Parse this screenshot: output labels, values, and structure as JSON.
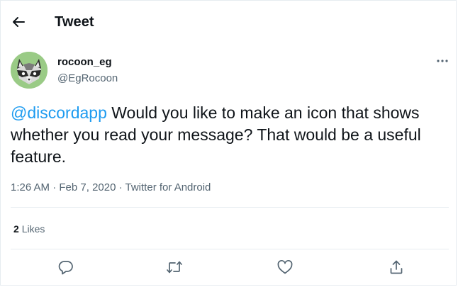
{
  "header": {
    "title": "Tweet",
    "back_icon": "arrow-left-icon"
  },
  "author": {
    "display_name": "rocoon_eg",
    "handle": "@EgRocoon",
    "avatar_icon": "raccoon-avatar",
    "more_icon": "ellipsis-icon"
  },
  "tweet": {
    "mention": "@discordapp",
    "text": " Would you like to make an icon that shows whether you read your message?  That would be a useful feature."
  },
  "meta": {
    "time": "1:26 AM",
    "separator": " · ",
    "date": "Feb 7, 2020",
    "source": "Twitter for Android"
  },
  "stats": {
    "likes_count": "2",
    "likes_label": "Likes"
  },
  "actions": [
    {
      "icon": "reply-icon"
    },
    {
      "icon": "retweet-icon"
    },
    {
      "icon": "like-icon"
    },
    {
      "icon": "share-icon"
    }
  ],
  "colors": {
    "accent": "#1d9bf0",
    "text": "#0f1419",
    "secondary": "#536471",
    "divider": "#e6ecf0"
  }
}
